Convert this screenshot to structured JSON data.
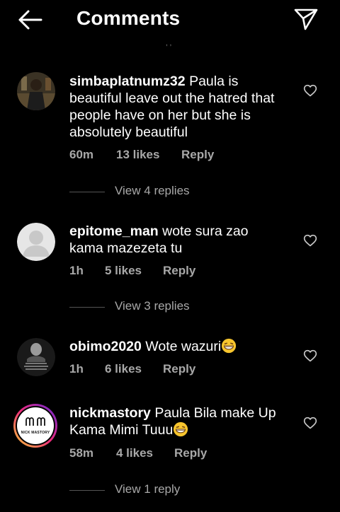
{
  "header": {
    "title": "Comments"
  },
  "comments": [
    {
      "username": "simbaplatnumz32",
      "text": "Paula is beautiful leave out the hatred that people have on her but she is absolutely beautiful",
      "time": "60m",
      "likes": "13 likes",
      "reply": "Reply",
      "view_replies": "View 4 replies"
    },
    {
      "username": "epitome_man",
      "text": "wote sura zao kama mazezeta tu",
      "time": "1h",
      "likes": "5 likes",
      "reply": "Reply",
      "view_replies": "View 3 replies"
    },
    {
      "username": "obimo2020",
      "text": "Wote wazuri",
      "time": "1h",
      "likes": "6 likes",
      "reply": "Reply"
    },
    {
      "username": "nickmastory",
      "text": "Paula Bila make Up Kama Mimi Tuuu",
      "time": "58m",
      "likes": "4 likes",
      "reply": "Reply",
      "view_replies": "View 1 reply",
      "avatar_logo_text": "NICK MASTORY"
    }
  ],
  "icons": {
    "back": "arrow-left-icon",
    "send": "paper-plane-icon",
    "heart": "heart-outline-icon",
    "emoji": "grinning-emoji"
  },
  "colors": {
    "background": "#000000",
    "text": "#ffffff",
    "secondary": "#a8a8a8"
  }
}
